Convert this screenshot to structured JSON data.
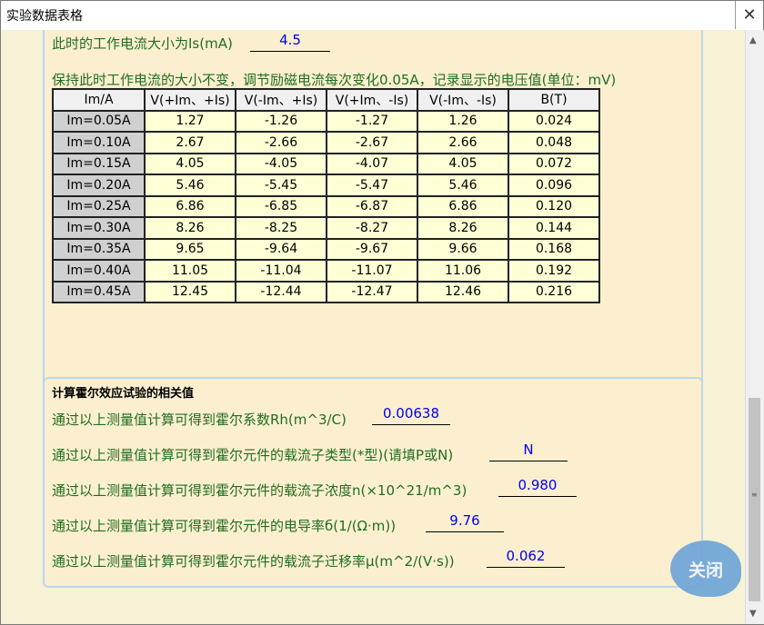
{
  "window": {
    "title": "实验数据表格",
    "close_symbol": "✕"
  },
  "current": {
    "label": "此时的工作电流大小为Is(mA)",
    "value": "4.5"
  },
  "instruction": "保持此时工作电流的大小不变，调节励磁电流每次变化0.05A，记录显示的电压值(单位：mV)",
  "table": {
    "headers": [
      "Im/A",
      "V(+Im、+Is)",
      "V(-Im、+Is)",
      "V(+Im、-Is)",
      "V(-Im、-Is)",
      "B(T)"
    ],
    "rows": [
      [
        "Im=0.05A",
        "1.27",
        "-1.26",
        "-1.27",
        "1.26",
        "0.024"
      ],
      [
        "Im=0.10A",
        "2.67",
        "-2.66",
        "-2.67",
        "2.66",
        "0.048"
      ],
      [
        "Im=0.15A",
        "4.05",
        "-4.05",
        "-4.07",
        "4.05",
        "0.072"
      ],
      [
        "Im=0.20A",
        "5.46",
        "-5.45",
        "-5.47",
        "5.46",
        "0.096"
      ],
      [
        "Im=0.25A",
        "6.86",
        "-6.85",
        "-6.87",
        "6.86",
        "0.120"
      ],
      [
        "Im=0.30A",
        "8.26",
        "-8.25",
        "-8.27",
        "8.26",
        "0.144"
      ],
      [
        "Im=0.35A",
        "9.65",
        "-9.64",
        "-9.67",
        "9.66",
        "0.168"
      ],
      [
        "Im=0.40A",
        "11.05",
        "-11.04",
        "-11.07",
        "11.06",
        "0.192"
      ],
      [
        "Im=0.45A",
        "12.45",
        "-12.44",
        "-12.47",
        "12.46",
        "0.216"
      ]
    ]
  },
  "calc": {
    "title": "计算霍尔效应试验的相关值",
    "rh": {
      "label": "通过以上测量值计算可得到霍尔系数Rh(m^3/C)",
      "value": "0.00638"
    },
    "type": {
      "label": "通过以上测量值计算可得到霍尔元件的载流子类型(*型)(请填P或N)",
      "value": "N"
    },
    "n": {
      "label": "通过以上测量值计算可得到霍尔元件的载流子浓度n(×10^21/m^3)",
      "value": "0.980"
    },
    "sigma": {
      "label": "通过以上测量值计算可得到霍尔元件的电导率б(1/(Ω·m))",
      "value": "9.76"
    },
    "mu": {
      "label": "通过以上测量值计算可得到霍尔元件的载流子迁移率μ(m^2/(V·s))",
      "value": "0.062"
    }
  },
  "close_label": "关闭",
  "colors": {
    "label_green": "#1f6e1f",
    "value_blue": "#0000ee",
    "panel": "#fcefcf",
    "cell": "#ffffd6",
    "row_header": "#d0d0d0"
  }
}
